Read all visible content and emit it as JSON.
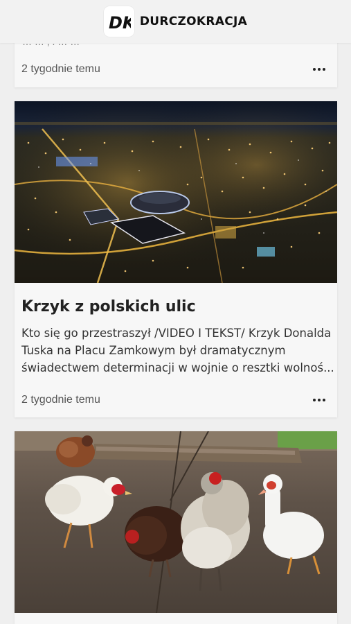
{
  "header": {
    "logo_text": "DK",
    "brand": "DURCZOKRACJA"
  },
  "posts": [
    {
      "excerpt_partial": "…  … , . … … ",
      "time": "2 tygodnie temu"
    },
    {
      "title": "Krzyk z polskich ulic",
      "excerpt_lines": [
        "Kto się go przestraszył /VIDEO I TEKST/ Krzyk Donalda",
        "Tuska na Placu Zamkowym był dramatycznym",
        "świadectwem determinacji w wojnie o resztki wolnoś..."
      ],
      "time": "2 tygodnie temu",
      "image": "night-city-aerial"
    },
    {
      "image": "chickens-and-ducks-farmyard"
    }
  ],
  "icons": {
    "more": "more-horizontal-icon"
  }
}
